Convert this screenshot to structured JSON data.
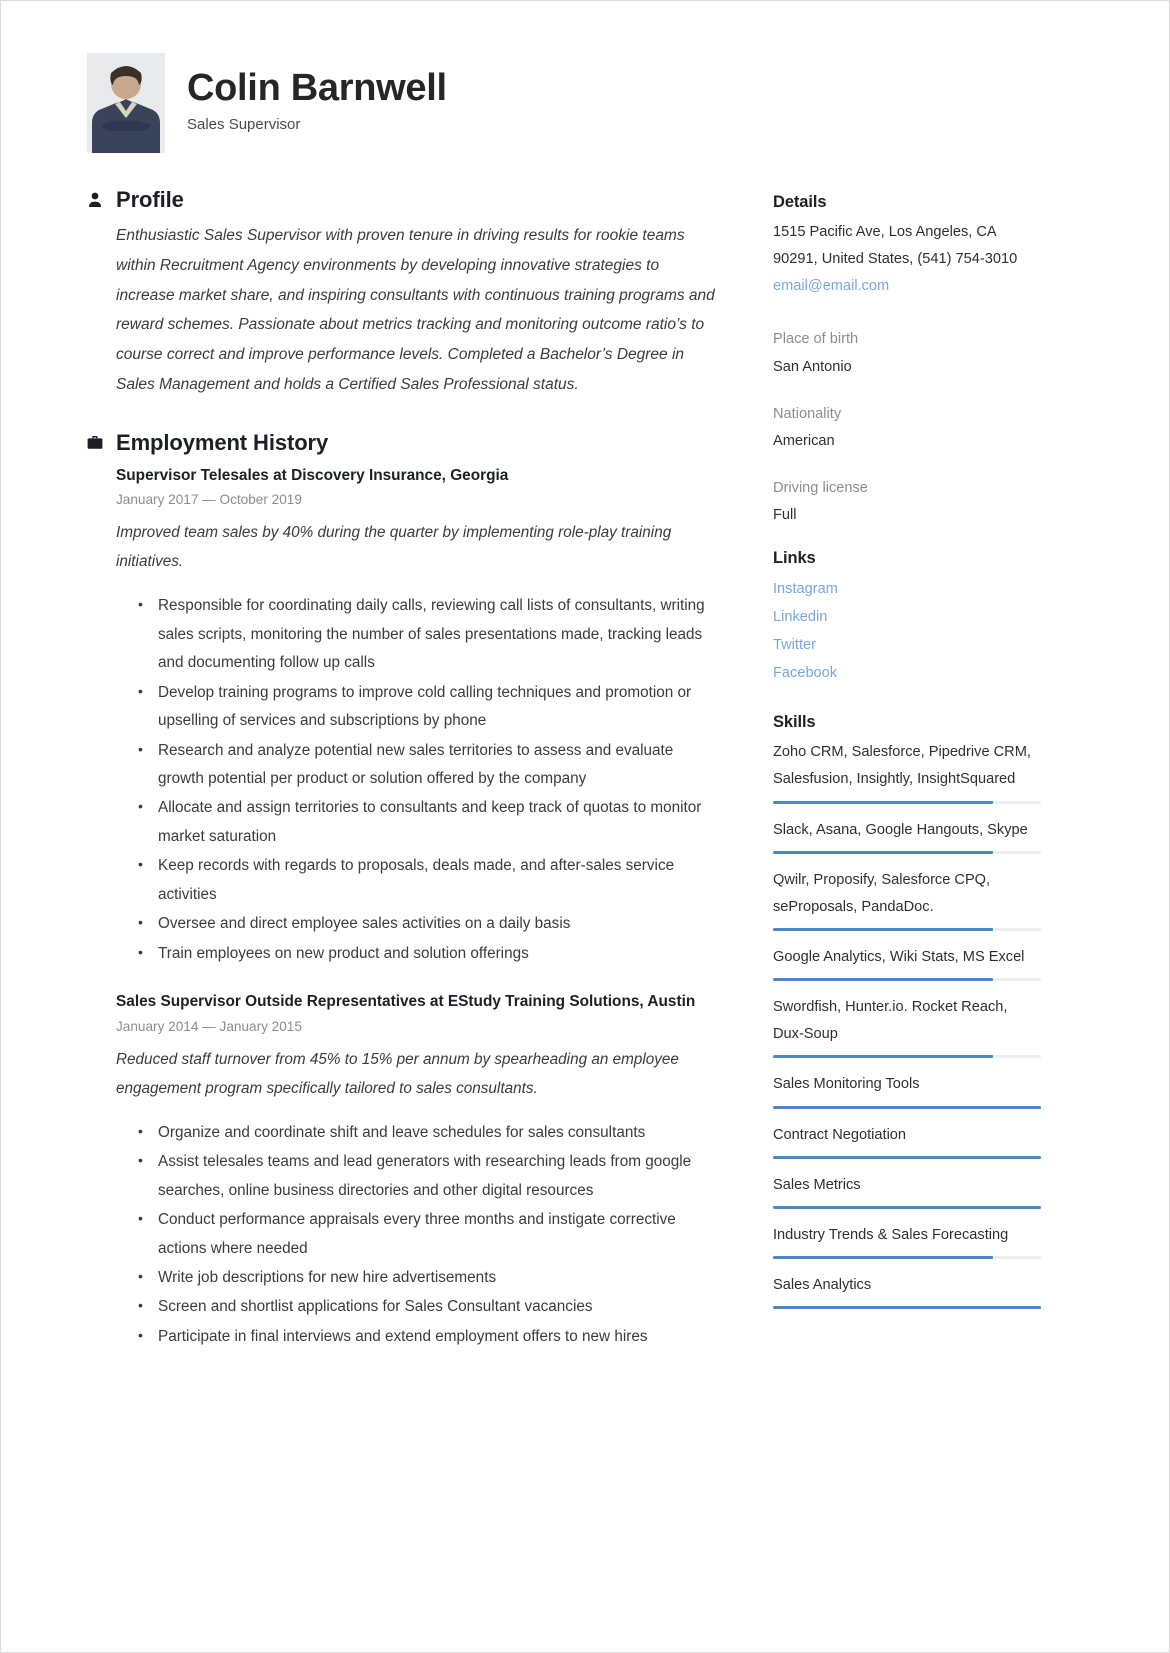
{
  "header": {
    "name": "Colin Barnwell",
    "job_title": "Sales Supervisor",
    "photo_alt": "profile-photo"
  },
  "profile": {
    "icon": "person-icon",
    "heading": "Profile",
    "text": "Enthusiastic Sales Supervisor with proven tenure in driving results for rookie teams within Recruitment Agency environments by developing innovative strategies to increase market share, and inspiring consultants with continuous training programs and reward schemes. Passionate about metrics tracking and monitoring outcome ratio’s to course correct and improve performance levels. Completed a Bachelor’s Degree in Sales Management and holds a Certified Sales Professional status."
  },
  "employment": {
    "icon": "briefcase-icon",
    "heading": "Employment History",
    "jobs": [
      {
        "title": "Supervisor Telesales at  Discovery Insurance, Georgia",
        "dates": "January 2017 — October 2019",
        "summary": "Improved team sales by 40% during the quarter by implementing role-play training initiatives.",
        "bullets": [
          "Responsible for coordinating daily calls, reviewing call lists of consultants, writing sales scripts, monitoring the number of sales presentations made, tracking leads and documenting follow up calls",
          "Develop training programs to improve cold calling techniques and promotion or upselling of services and subscriptions by phone",
          "Research and analyze potential new sales territories to assess and evaluate growth potential per product or solution offered by the company",
          "Allocate and assign territories to consultants and keep track of quotas to monitor market saturation",
          "Keep records with regards to proposals, deals made, and after-sales service activities",
          "Oversee and direct employee sales activities on a daily basis",
          "Train employees on new product and solution offerings"
        ]
      },
      {
        "title": "Sales  Supervisor Outside Representatives at  EStudy Training Solutions, Austin",
        "dates": "January 2014 — January 2015",
        "summary": "Reduced staff turnover from 45% to 15% per annum by spearheading an employee engagement program specifically tailored to sales consultants.",
        "bullets": [
          "Organize and coordinate shift and leave schedules for sales consultants",
          "Assist telesales teams and lead generators with researching leads from google searches, online business directories and other digital resources",
          "Conduct performance appraisals every three months and instigate corrective actions where needed",
          "Write job descriptions for new hire advertisements",
          "Screen and shortlist applications for Sales Consultant vacancies",
          "Participate in final interviews and extend employment offers to new hires"
        ]
      }
    ]
  },
  "details": {
    "heading": "Details",
    "address": "1515 Pacific Ave, Los Angeles, CA 90291, United States, (541) 754-3010",
    "email": "email@email.com",
    "fields": [
      {
        "label": "Place of birth",
        "value": "San Antonio"
      },
      {
        "label": "Nationality",
        "value": "American"
      },
      {
        "label": "Driving license",
        "value": "Full"
      }
    ]
  },
  "links": {
    "heading": "Links",
    "items": [
      {
        "label": "Instagram"
      },
      {
        "label": "Linkedin"
      },
      {
        "label": "Twitter"
      },
      {
        "label": "Facebook"
      }
    ]
  },
  "skills": {
    "heading": "Skills",
    "items": [
      {
        "name": "Zoho CRM, Salesforce, Pipedrive CRM, Salesfusion, Insightly, InsightSquared",
        "level": 82
      },
      {
        "name": "Slack, Asana, Google Hangouts, Skype",
        "level": 82
      },
      {
        "name": "Qwilr, Proposify, Salesforce CPQ, seProposals, PandaDoc.",
        "level": 82
      },
      {
        "name": "Google Analytics, Wiki Stats, MS Excel",
        "level": 82
      },
      {
        "name": "Swordfish, Hunter.io. Rocket Reach, Dux-Soup",
        "level": 82
      },
      {
        "name": "Sales Monitoring Tools",
        "level": 100
      },
      {
        "name": "Contract Negotiation",
        "level": 100
      },
      {
        "name": "Sales Metrics",
        "level": 100
      },
      {
        "name": "Industry Trends & Sales Forecasting",
        "level": 82
      },
      {
        "name": "Sales Analytics",
        "level": 100
      }
    ]
  },
  "colors": {
    "accent": "#4a88c7",
    "link": "#7aa6d6",
    "heading": "#1c2026",
    "body": "#3b3b3b",
    "muted": "#8d8d8d",
    "track": "#eceff1"
  }
}
